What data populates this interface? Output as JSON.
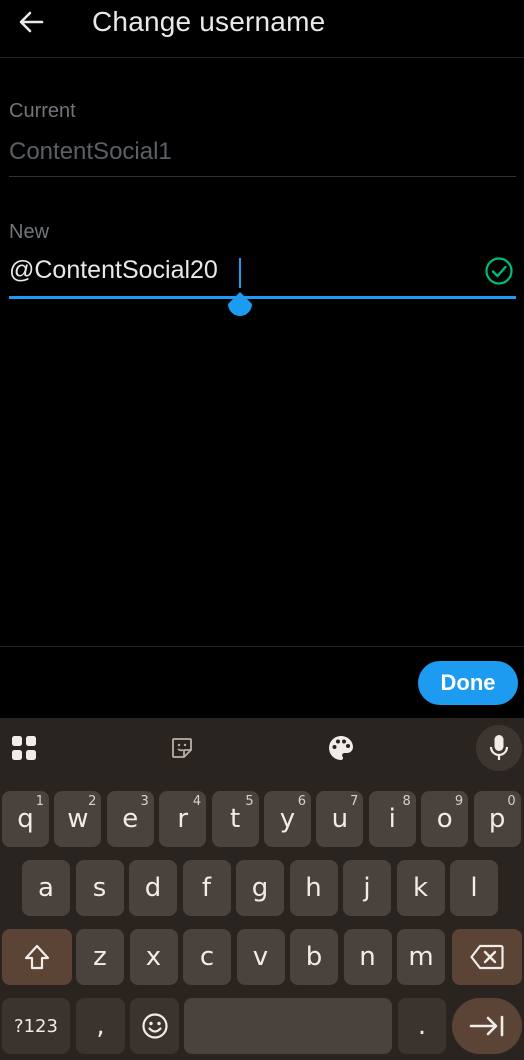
{
  "header": {
    "title": "Change username"
  },
  "current": {
    "label": "Current",
    "value": "ContentSocial1"
  },
  "new_field": {
    "label": "New",
    "value": "@ContentSocial20"
  },
  "actions": {
    "done_label": "Done"
  },
  "keyboard": {
    "row1": [
      {
        "key": "q",
        "hint": "1"
      },
      {
        "key": "w",
        "hint": "2"
      },
      {
        "key": "e",
        "hint": "3"
      },
      {
        "key": "r",
        "hint": "4"
      },
      {
        "key": "t",
        "hint": "5"
      },
      {
        "key": "y",
        "hint": "6"
      },
      {
        "key": "u",
        "hint": "7"
      },
      {
        "key": "i",
        "hint": "8"
      },
      {
        "key": "o",
        "hint": "9"
      },
      {
        "key": "p",
        "hint": "0"
      }
    ],
    "row2": [
      "a",
      "s",
      "d",
      "f",
      "g",
      "h",
      "j",
      "k",
      "l"
    ],
    "row3": [
      "z",
      "x",
      "c",
      "v",
      "b",
      "n",
      "m"
    ],
    "row4": {
      "symbols_label": "?123",
      "comma_label": ",",
      "period_label": "."
    }
  },
  "colors": {
    "accent": "#1d9bf0",
    "success": "#00ba7c",
    "background": "#000000",
    "keyboard_bg": "#2a2420"
  }
}
